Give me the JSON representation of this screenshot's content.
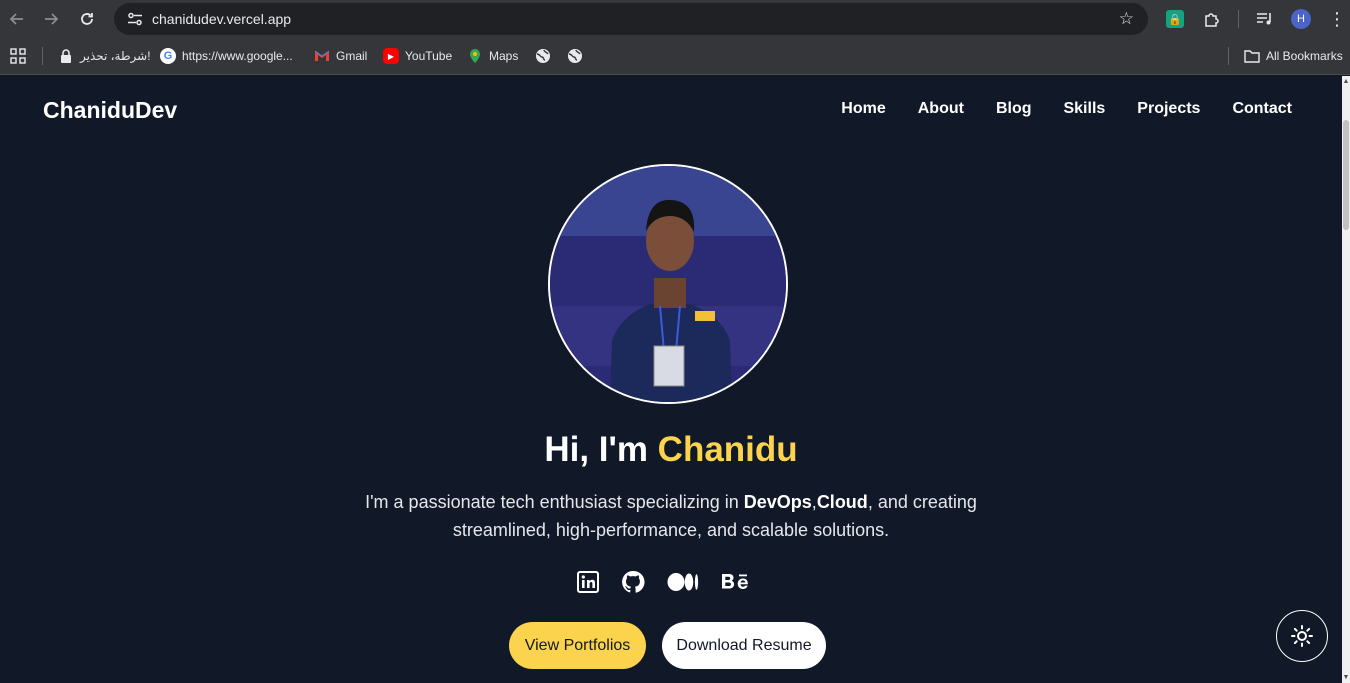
{
  "browser": {
    "url": "chanidudev.vercel.app",
    "avatar_letter": "H",
    "bookmarks": [
      {
        "label": "شرطة، تحذير!",
        "icon": "lock-icon"
      },
      {
        "label": "https://www.google...",
        "icon": "google-icon"
      },
      {
        "label": "Gmail",
        "icon": "gmail-icon"
      },
      {
        "label": "YouTube",
        "icon": "youtube-icon"
      },
      {
        "label": "Maps",
        "icon": "maps-icon"
      }
    ],
    "all_bookmarks": "All Bookmarks"
  },
  "site": {
    "logo": "ChaniduDev",
    "nav": [
      "Home",
      "About",
      "Blog",
      "Skills",
      "Projects",
      "Contact"
    ],
    "hero": {
      "greeting": "Hi, I'm ",
      "name": "Chanidu",
      "text_1": "I'm a passionate tech enthusiast specializing in ",
      "bold_1": "DevOps",
      "comma": ",",
      "bold_2": "Cloud",
      "text_2": ", and creating",
      "text_3": "streamlined, high-performance, and scalable solutions."
    },
    "socials": [
      "linkedin-icon",
      "github-icon",
      "medium-icon",
      "behance-icon"
    ],
    "buttons": {
      "primary": "View Portfolios",
      "secondary": "Download Resume"
    },
    "colors": {
      "background": "#111827",
      "accent": "#fcd34d"
    }
  }
}
